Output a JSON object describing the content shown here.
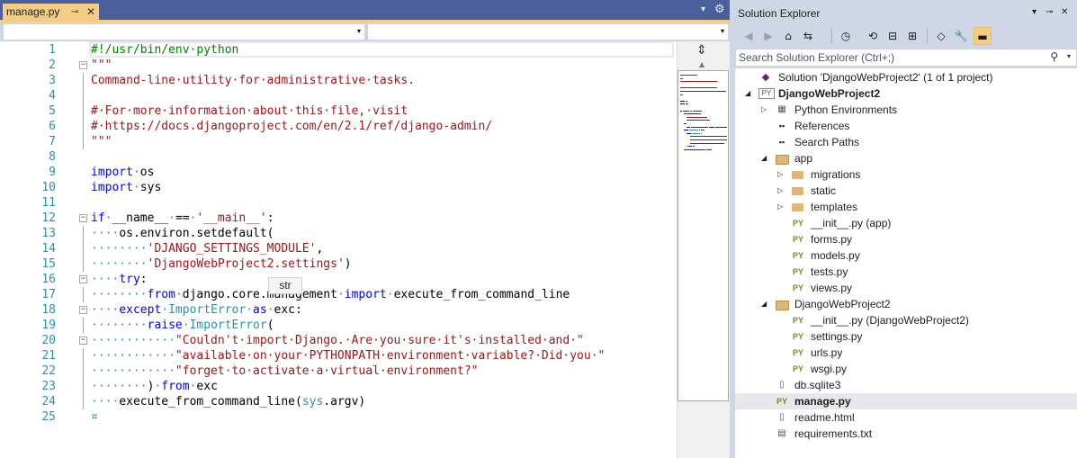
{
  "editor": {
    "tab": {
      "label": "manage.py",
      "pin": "⊸",
      "close": "✕"
    },
    "tab_overflow": "▾",
    "tab_settings": "⚙",
    "nav": {
      "left_arrow": "▾",
      "right_arrow": "▾"
    },
    "tooltip": "str",
    "scrollbar": {
      "split": "⇕",
      "up": "▲"
    },
    "lines": [
      {
        "n": "1",
        "fold": "",
        "guide": false,
        "tokens": [
          [
            "c",
            "#!/usr/bin/env·python"
          ]
        ]
      },
      {
        "n": "2",
        "fold": "−",
        "guide": false,
        "tokens": [
          [
            "s",
            "\"\"\""
          ]
        ]
      },
      {
        "n": "3",
        "fold": "",
        "guide": true,
        "tokens": [
          [
            "s",
            "Command-line·utility·for·administrative·tasks."
          ]
        ]
      },
      {
        "n": "4",
        "fold": "",
        "guide": true,
        "tokens": []
      },
      {
        "n": "5",
        "fold": "",
        "guide": true,
        "tokens": [
          [
            "s",
            "#·For·more·information·about·this·file,·visit"
          ]
        ]
      },
      {
        "n": "6",
        "fold": "",
        "guide": true,
        "tokens": [
          [
            "s",
            "#·https://docs.djangoproject.com/en/2.1/ref/django-admin/"
          ]
        ]
      },
      {
        "n": "7",
        "fold": "",
        "guide": true,
        "tokens": [
          [
            "s",
            "\"\"\""
          ]
        ]
      },
      {
        "n": "8",
        "fold": "",
        "guide": false,
        "tokens": []
      },
      {
        "n": "9",
        "fold": "",
        "guide": false,
        "tokens": [
          [
            "k",
            "import"
          ],
          [
            "w",
            "·"
          ],
          [
            "n",
            "os"
          ]
        ]
      },
      {
        "n": "10",
        "fold": "",
        "guide": false,
        "tokens": [
          [
            "k",
            "import"
          ],
          [
            "w",
            "·"
          ],
          [
            "n",
            "sys"
          ]
        ]
      },
      {
        "n": "11",
        "fold": "",
        "guide": false,
        "tokens": []
      },
      {
        "n": "12",
        "fold": "−",
        "guide": false,
        "tokens": [
          [
            "k",
            "if"
          ],
          [
            "w",
            "·"
          ],
          [
            "n",
            "__name__"
          ],
          [
            "w",
            "·"
          ],
          [
            "n",
            "=="
          ],
          [
            "w",
            "·"
          ],
          [
            "s",
            "'__main__'"
          ],
          [
            "n",
            ":"
          ]
        ]
      },
      {
        "n": "13",
        "fold": "",
        "guide": true,
        "tokens": [
          [
            "w",
            "····"
          ],
          [
            "n",
            "os.environ.setdefault("
          ]
        ]
      },
      {
        "n": "14",
        "fold": "",
        "guide": true,
        "tokens": [
          [
            "w",
            "········"
          ],
          [
            "s",
            "'DJANGO_SETTINGS_MODULE'"
          ],
          [
            "n",
            ","
          ]
        ]
      },
      {
        "n": "15",
        "fold": "",
        "guide": true,
        "tokens": [
          [
            "w",
            "········"
          ],
          [
            "s",
            "'DjangoWebProject2.settings'"
          ],
          [
            "n",
            ")"
          ]
        ]
      },
      {
        "n": "16",
        "fold": "−",
        "guide": false,
        "tokens": [
          [
            "w",
            "····"
          ],
          [
            "k",
            "try"
          ],
          [
            "n",
            ":"
          ]
        ]
      },
      {
        "n": "17",
        "fold": "",
        "guide": true,
        "tokens": [
          [
            "w",
            "········"
          ],
          [
            "k",
            "from"
          ],
          [
            "w",
            "·"
          ],
          [
            "n",
            "django.core.management"
          ],
          [
            "w",
            "·"
          ],
          [
            "k",
            "import"
          ],
          [
            "w",
            "·"
          ],
          [
            "n",
            "execute_from_command_line"
          ]
        ]
      },
      {
        "n": "18",
        "fold": "−",
        "guide": false,
        "tokens": [
          [
            "w",
            "····"
          ],
          [
            "k",
            "except"
          ],
          [
            "w",
            "·"
          ],
          [
            "ws",
            "ImportError"
          ],
          [
            "w",
            "·"
          ],
          [
            "k",
            "as"
          ],
          [
            "w",
            "·"
          ],
          [
            "n",
            "exc:"
          ]
        ]
      },
      {
        "n": "19",
        "fold": "",
        "guide": true,
        "tokens": [
          [
            "w",
            "········"
          ],
          [
            "k",
            "raise"
          ],
          [
            "w",
            "·"
          ],
          [
            "ws",
            "ImportError"
          ],
          [
            "n",
            "("
          ]
        ]
      },
      {
        "n": "20",
        "fold": "−",
        "guide": false,
        "tokens": [
          [
            "w",
            "············"
          ],
          [
            "s",
            "\"Couldn't·import·Django.·Are·you·sure·it's·installed·and·\""
          ]
        ]
      },
      {
        "n": "21",
        "fold": "",
        "guide": true,
        "tokens": [
          [
            "w",
            "············"
          ],
          [
            "s",
            "\"available·on·your·PYTHONPATH·environment·variable?·Did·you·\""
          ]
        ]
      },
      {
        "n": "22",
        "fold": "",
        "guide": true,
        "tokens": [
          [
            "w",
            "············"
          ],
          [
            "s",
            "\"forget·to·activate·a·virtual·environment?\""
          ]
        ]
      },
      {
        "n": "23",
        "fold": "",
        "guide": true,
        "tokens": [
          [
            "w",
            "········"
          ],
          [
            "n",
            ")"
          ],
          [
            "w",
            "·"
          ],
          [
            "k",
            "from"
          ],
          [
            "w",
            "·"
          ],
          [
            "n",
            "exc"
          ]
        ]
      },
      {
        "n": "24",
        "fold": "",
        "guide": true,
        "tokens": [
          [
            "w",
            "····"
          ],
          [
            "n",
            "execute_from_command_line("
          ],
          [
            "ws",
            "sys"
          ],
          [
            "n",
            ".argv)"
          ]
        ]
      },
      {
        "n": "25",
        "fold": "",
        "guide": false,
        "tokens": [
          [
            "w",
            "¤"
          ]
        ]
      }
    ]
  },
  "solution_explorer": {
    "title": "Solution Explorer",
    "title_buttons": [
      "▾",
      "⊸",
      "✕"
    ],
    "toolbar": {
      "back": "◀",
      "forward": "▶",
      "home": "⌂",
      "switch_views": "⇆",
      "pending": "◷",
      "sync": "⟲",
      "collapse": "⊟",
      "show_all": "⊞",
      "preview": "◇",
      "properties": "🔧",
      "pin": "▬"
    },
    "search": {
      "placeholder": "Search Solution Explorer (Ctrl+;)",
      "icon": "⚲",
      "dropdown": "▾"
    },
    "tree": [
      {
        "label": "Solution 'DjangoWebProject2' (1 of 1 project)",
        "icon": "sln",
        "glyph": "◆",
        "exp": "",
        "depth": 0,
        "bold": false,
        "selected": false
      },
      {
        "label": "DjangoWebProject2",
        "icon": "proj",
        "glyph": "PY",
        "exp": "◢",
        "depth": 0,
        "bold": true,
        "selected": false
      },
      {
        "label": "Python Environments",
        "icon": "file",
        "glyph": "▦",
        "exp": "▷",
        "depth": 1,
        "bold": false,
        "selected": false
      },
      {
        "label": "References",
        "icon": "refs",
        "glyph": "▪▪",
        "exp": "",
        "depth": 1,
        "bold": false,
        "selected": false
      },
      {
        "label": "Search Paths",
        "icon": "refs",
        "glyph": "▪▪",
        "exp": "",
        "depth": 1,
        "bold": false,
        "selected": false
      },
      {
        "label": "app",
        "icon": "folder-open",
        "glyph": "",
        "exp": "◢",
        "depth": 1,
        "bold": false,
        "selected": false
      },
      {
        "label": "migrations",
        "icon": "folder",
        "glyph": "",
        "exp": "▷",
        "depth": 2,
        "bold": false,
        "selected": false
      },
      {
        "label": "static",
        "icon": "folder",
        "glyph": "",
        "exp": "▷",
        "depth": 2,
        "bold": false,
        "selected": false
      },
      {
        "label": "templates",
        "icon": "folder",
        "glyph": "",
        "exp": "▷",
        "depth": 2,
        "bold": false,
        "selected": false
      },
      {
        "label": "__init__.py (app)",
        "icon": "py",
        "glyph": "PY",
        "exp": "",
        "depth": 2,
        "bold": false,
        "selected": false
      },
      {
        "label": "forms.py",
        "icon": "py",
        "glyph": "PY",
        "exp": "",
        "depth": 2,
        "bold": false,
        "selected": false
      },
      {
        "label": "models.py",
        "icon": "py",
        "glyph": "PY",
        "exp": "",
        "depth": 2,
        "bold": false,
        "selected": false
      },
      {
        "label": "tests.py",
        "icon": "py",
        "glyph": "PY",
        "exp": "",
        "depth": 2,
        "bold": false,
        "selected": false
      },
      {
        "label": "views.py",
        "icon": "py",
        "glyph": "PY",
        "exp": "",
        "depth": 2,
        "bold": false,
        "selected": false
      },
      {
        "label": "DjangoWebProject2",
        "icon": "folder-open",
        "glyph": "",
        "exp": "◢",
        "depth": 1,
        "bold": false,
        "selected": false
      },
      {
        "label": "__init__.py (DjangoWebProject2)",
        "icon": "py",
        "glyph": "PY",
        "exp": "",
        "depth": 2,
        "bold": false,
        "selected": false
      },
      {
        "label": "settings.py",
        "icon": "py",
        "glyph": "PY",
        "exp": "",
        "depth": 2,
        "bold": false,
        "selected": false
      },
      {
        "label": "urls.py",
        "icon": "py",
        "glyph": "PY",
        "exp": "",
        "depth": 2,
        "bold": false,
        "selected": false
      },
      {
        "label": "wsgi.py",
        "icon": "py",
        "glyph": "PY",
        "exp": "",
        "depth": 2,
        "bold": false,
        "selected": false
      },
      {
        "label": "db.sqlite3",
        "icon": "file",
        "glyph": "▯",
        "exp": "",
        "depth": 1,
        "bold": false,
        "selected": false
      },
      {
        "label": "manage.py",
        "icon": "py",
        "glyph": "PY",
        "exp": "",
        "depth": 1,
        "bold": true,
        "selected": true
      },
      {
        "label": "readme.html",
        "icon": "file",
        "glyph": "▯",
        "exp": "",
        "depth": 1,
        "bold": false,
        "selected": false
      },
      {
        "label": "requirements.txt",
        "icon": "file",
        "glyph": "▤",
        "exp": "",
        "depth": 1,
        "bold": false,
        "selected": false
      }
    ]
  },
  "colors": {
    "tab_strip": "#4a5f9c",
    "active_tab": "#f5cc84",
    "comment": "#008000",
    "string": "#a31515",
    "keyword": "#0000ff",
    "line_number": "#2b91af",
    "python_icon": "#6c8f1f"
  }
}
